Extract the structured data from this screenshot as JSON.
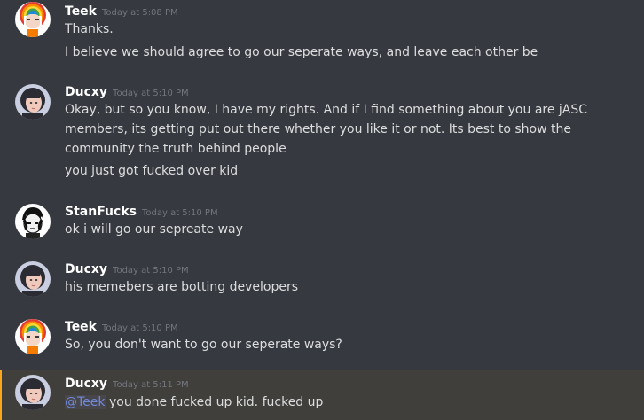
{
  "colors": {
    "background": "#36393f",
    "mention_highlight_bg": "#413f3c",
    "mention_bar": "#faa61a",
    "mention_text": "#7289da",
    "username": "#ffffff",
    "message_text": "#dcddde",
    "timestamp": "#72767d"
  },
  "messages": [
    {
      "author": "Teek",
      "timestamp": "Today at 5:08 PM",
      "avatar_icon": "rainbow-hair-avatar-icon",
      "lines": [
        "Thanks.",
        "I believe we should agree to go our seperate ways, and leave each other be"
      ]
    },
    {
      "author": "Ducxy",
      "timestamp": "Today at 5:10 PM",
      "avatar_icon": "girl-portrait-avatar-icon",
      "lines": [
        "Okay, but so you know, I have my rights. And if I find something about you are jASC members, its getting put out there whether you like it or not. Its best to show the community the truth behind people",
        "you just got fucked over kid"
      ]
    },
    {
      "author": "StanFucks",
      "timestamp": "Today at 5:10 PM",
      "avatar_icon": "cartoon-face-avatar-icon",
      "lines": [
        "ok i will go our sepreate way"
      ]
    },
    {
      "author": "Ducxy",
      "timestamp": "Today at 5:10 PM",
      "avatar_icon": "girl-portrait-avatar-icon",
      "lines": [
        "his memebers are botting developers"
      ]
    },
    {
      "author": "Teek",
      "timestamp": "Today at 5:10 PM",
      "avatar_icon": "rainbow-hair-avatar-icon",
      "lines": [
        "So, you don't want to go our seperate ways?"
      ]
    },
    {
      "author": "Ducxy",
      "timestamp": "Today at 5:11 PM",
      "avatar_icon": "girl-portrait-avatar-icon",
      "mention": "@Teek",
      "lines": [
        " you done fucked up kid. fucked up"
      ]
    }
  ]
}
